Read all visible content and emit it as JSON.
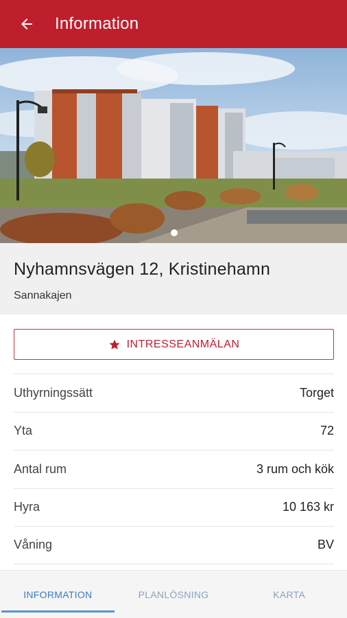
{
  "appbar": {
    "title": "Information",
    "back_icon": "arrow-back-icon",
    "color": "#bf1e2d"
  },
  "hero": {
    "image": "apartment-building-photo",
    "pager": {
      "count": 1,
      "active": 0
    }
  },
  "listing": {
    "address": "Nyhamnsvägen 12, Kristinehamn",
    "area": "Sannakajen"
  },
  "interest_button": {
    "label": "INTRESSEANMÄLAN",
    "icon": "star-icon"
  },
  "details": [
    {
      "label": "Uthyrningssätt",
      "value": "Torget"
    },
    {
      "label": "Yta",
      "value": "72"
    },
    {
      "label": "Antal rum",
      "value": "3 rum och kök"
    },
    {
      "label": "Hyra",
      "value": "10 163 kr"
    },
    {
      "label": "Våning",
      "value": "BV"
    }
  ],
  "tabs": [
    {
      "label": "INFORMATION",
      "active": true
    },
    {
      "label": "PLANLÖSNING",
      "active": false
    },
    {
      "label": "KARTA",
      "active": false
    }
  ]
}
